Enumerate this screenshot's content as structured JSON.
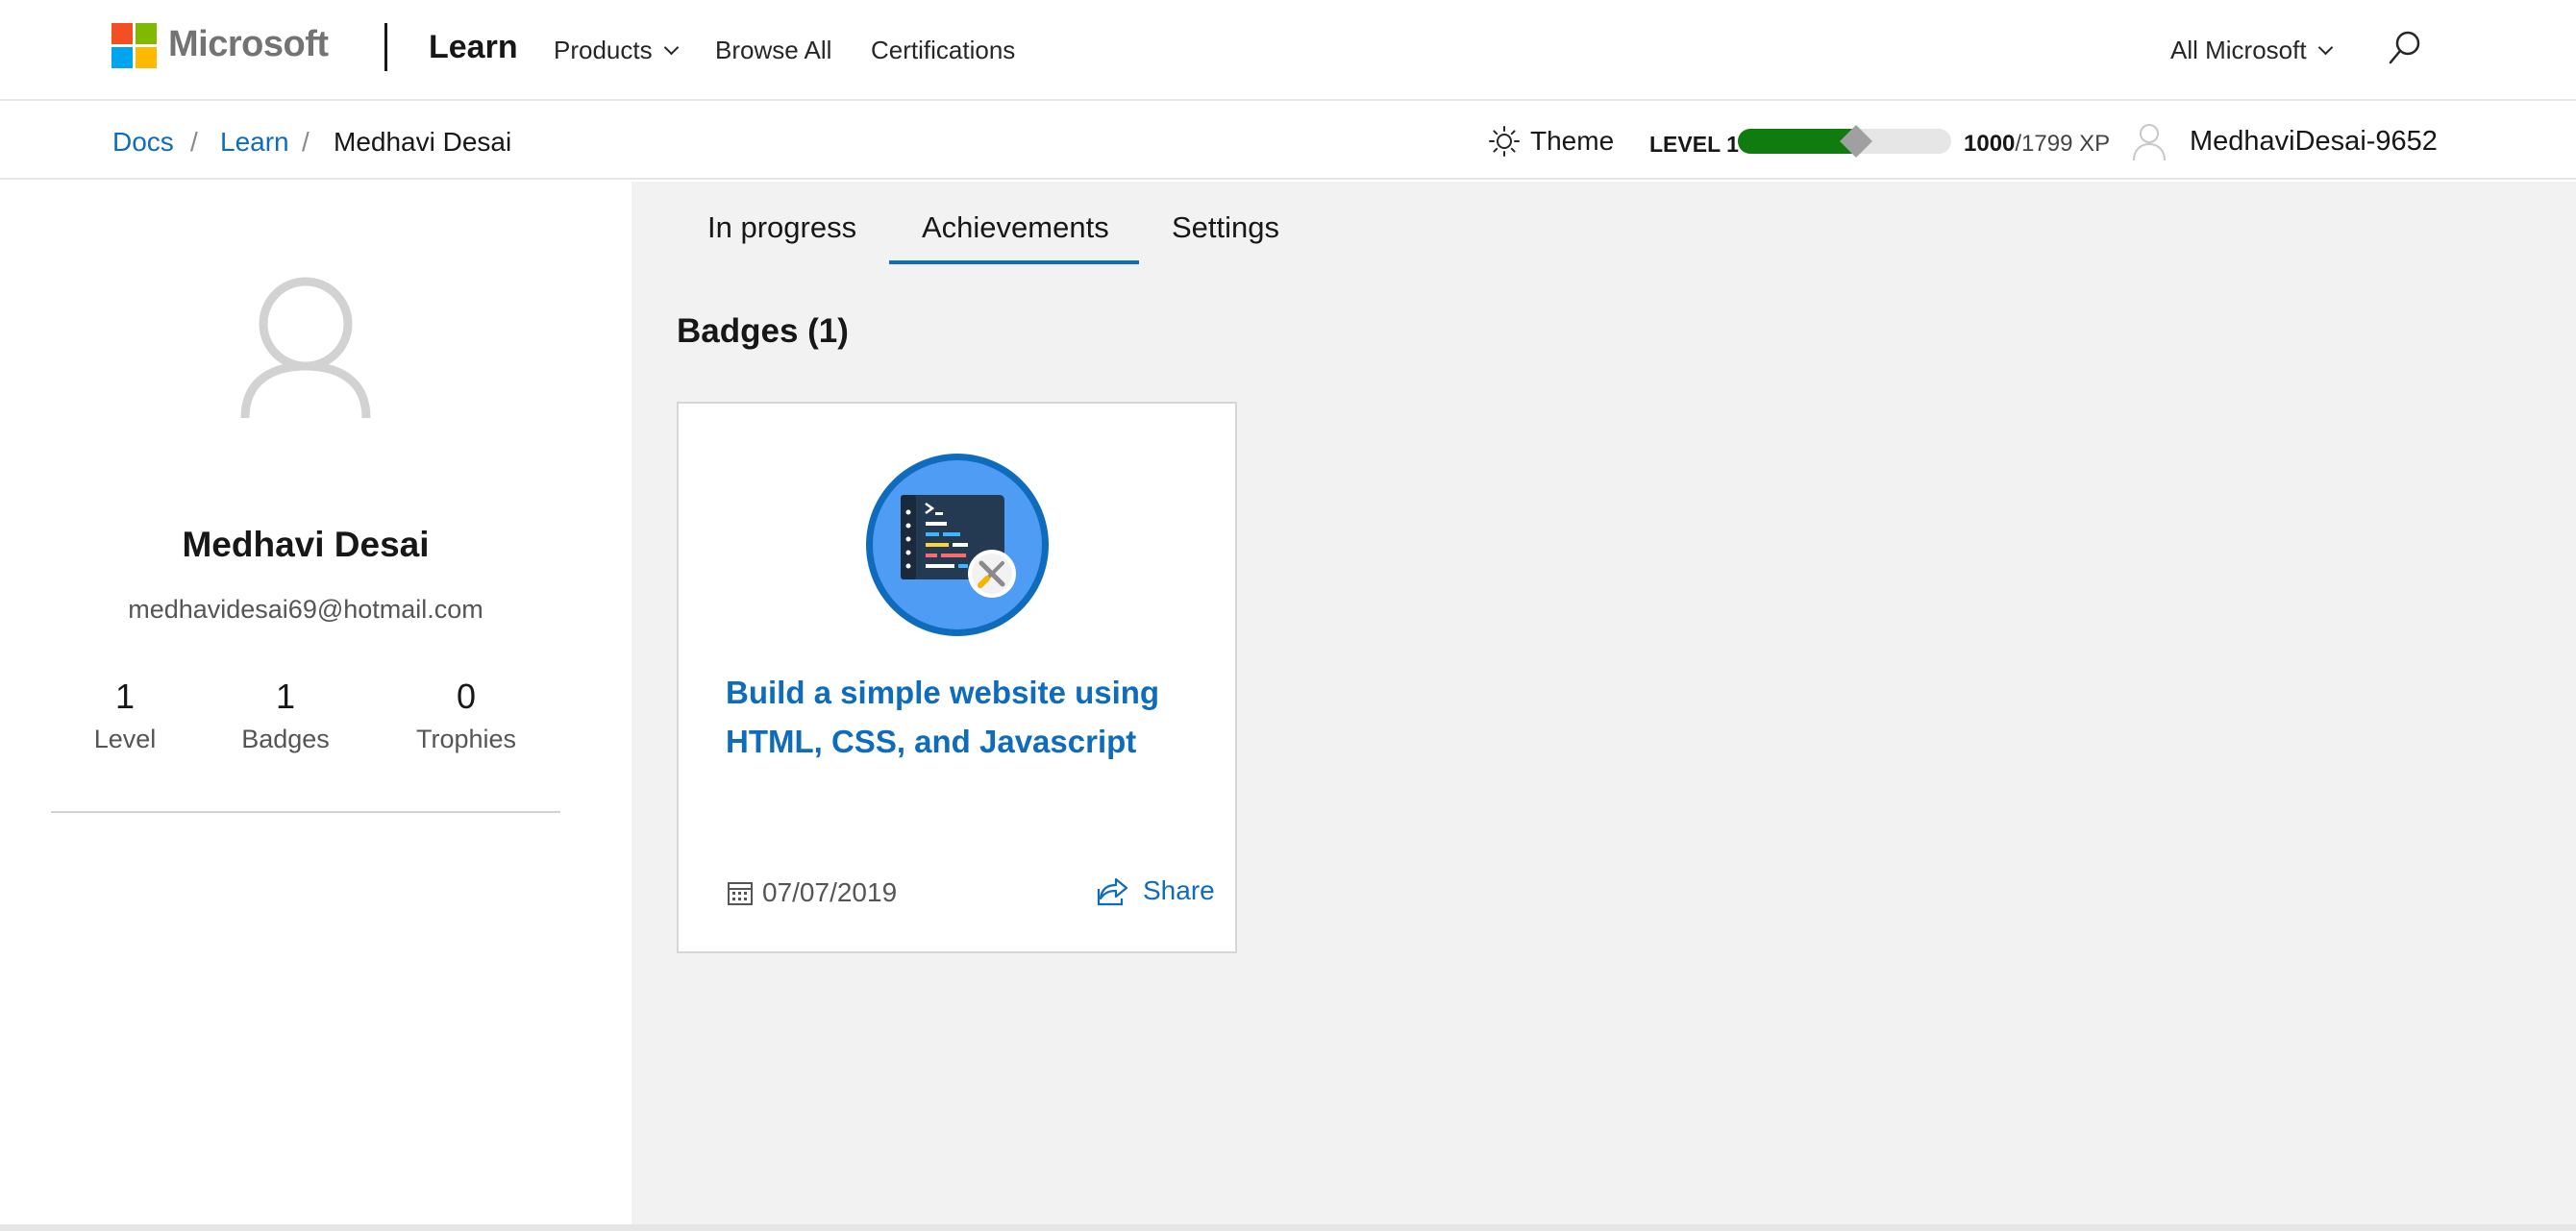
{
  "header": {
    "brand": "Microsoft",
    "site": "Learn",
    "nav": [
      {
        "label": "Products",
        "has_dropdown": true
      },
      {
        "label": "Browse All",
        "has_dropdown": false
      },
      {
        "label": "Certifications",
        "has_dropdown": false
      }
    ],
    "all_microsoft": "All Microsoft",
    "logo_colors": [
      "#f25022",
      "#7fba00",
      "#00a4ef",
      "#ffb900"
    ]
  },
  "breadcrumb": {
    "items": [
      "Docs",
      "Learn"
    ],
    "separator": "/",
    "current": "Medhavi Desai"
  },
  "status": {
    "theme_label": "Theme",
    "level_label": "LEVEL 1",
    "xp_current": "1000",
    "xp_total_text": "/1799 XP",
    "xp_progress": 0.556,
    "username": "MedhaviDesai-9652"
  },
  "profile": {
    "name": "Medhavi Desai",
    "email": "medhavidesai69@hotmail.com",
    "stats": [
      {
        "value": "1",
        "label": "Level"
      },
      {
        "value": "1",
        "label": "Badges"
      },
      {
        "value": "0",
        "label": "Trophies"
      }
    ]
  },
  "tabs": {
    "items": [
      "In progress",
      "Achievements",
      "Settings"
    ],
    "active": "Achievements"
  },
  "badges": {
    "title": "Badges (1)",
    "cards": [
      {
        "title": "Build a simple website using HTML, CSS, and Javascript",
        "date": "07/07/2019",
        "share_label": "Share"
      }
    ]
  },
  "colors": {
    "link": "#0f6cbd",
    "xp_fill": "#107c10",
    "main_bg": "#f2f2f2"
  }
}
